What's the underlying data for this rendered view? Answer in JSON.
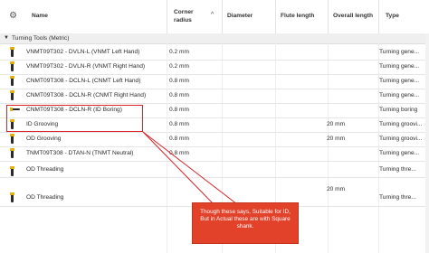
{
  "header": {
    "settings_icon": "gear-icon",
    "name": "Name",
    "corner_radius": "Corner\nradius",
    "sort_icon": "caret-up-icon",
    "diameter": "Diameter",
    "flute_length": "Flute length",
    "overall_length": "Overall length",
    "type": "Type"
  },
  "group": {
    "expander_icon": "caret-down-icon",
    "label": "Turning Tools (Metric)"
  },
  "rows": [
    {
      "name": "VNMT09T302 - DVLN-L (VNMT Left Hand)",
      "corner_radius": "0.2 mm",
      "diameter": "",
      "flute_length": "",
      "overall_length": "",
      "type": "Turning gene..."
    },
    {
      "name": "VNMT09T302 - DVLN-R (VNMT Right Hand)",
      "corner_radius": "0.2 mm",
      "diameter": "",
      "flute_length": "",
      "overall_length": "",
      "type": "Turning gene..."
    },
    {
      "name": "CNMT09T308 - DCLN-L (CNMT Left Hand)",
      "corner_radius": "0.8 mm",
      "diameter": "",
      "flute_length": "",
      "overall_length": "",
      "type": "Turning gene..."
    },
    {
      "name": "CNMT09T308 - DCLN-R (CNMT Right Hand)",
      "corner_radius": "0.8 mm",
      "diameter": "",
      "flute_length": "",
      "overall_length": "",
      "type": "Turning gene..."
    },
    {
      "name": "CNMT09T308 - DCLN-R (ID Boring)",
      "corner_radius": "0.8 mm",
      "diameter": "",
      "flute_length": "",
      "overall_length": "",
      "type": "Turning boring"
    },
    {
      "name": "ID Grooving",
      "corner_radius": "0.8 mm",
      "diameter": "",
      "flute_length": "",
      "overall_length": "20 mm",
      "type": "Turning groovi..."
    },
    {
      "name": "OD Grooving",
      "corner_radius": "0.8 mm",
      "diameter": "",
      "flute_length": "",
      "overall_length": "20 mm",
      "type": "Turning groovi..."
    },
    {
      "name": "TNMT09T308 - DTAN-N (TNMT Neutral)",
      "corner_radius": "0.8 mm",
      "diameter": "",
      "flute_length": "",
      "overall_length": "",
      "type": "Turning gene..."
    },
    {
      "name": "OD Threading",
      "corner_radius": "",
      "diameter": "",
      "flute_length": "",
      "overall_length": "",
      "type": "Turning thre..."
    },
    {
      "name": "OD Threading",
      "corner_radius": "",
      "diameter": "",
      "flute_length": "",
      "overall_length": "20 mm",
      "type": "Turning thre..."
    }
  ],
  "annotation": {
    "text": "Though these says, Suitable for ID, But in Actual these are with Square shank.",
    "color": "#e2412a",
    "outline_color": "#d9262a"
  }
}
